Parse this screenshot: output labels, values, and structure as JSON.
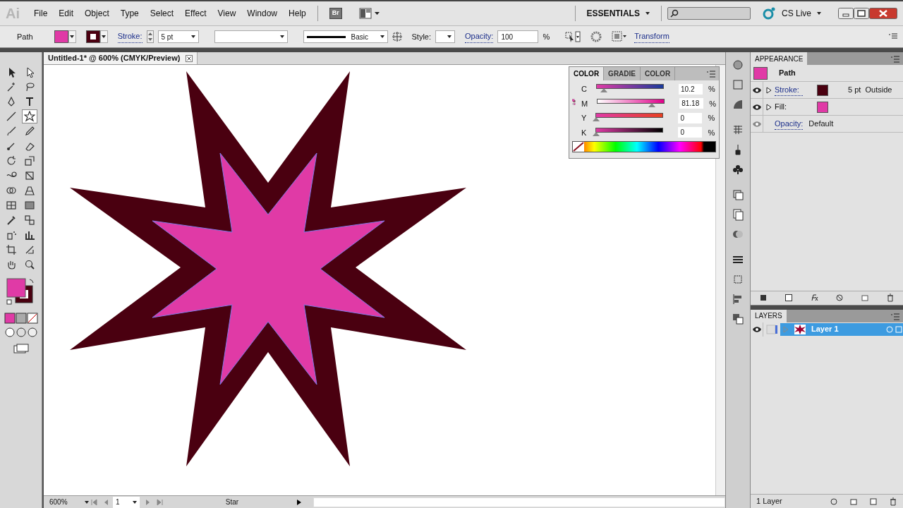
{
  "app": {
    "logo": "Ai",
    "menus": [
      "File",
      "Edit",
      "Object",
      "Type",
      "Select",
      "Effect",
      "View",
      "Window",
      "Help"
    ],
    "bridge": "Br",
    "workspace": "ESSENTIALS",
    "cs_live": "CS Live"
  },
  "control_bar": {
    "selection": "Path",
    "stroke_label": "Stroke:",
    "stroke_weight": "5 pt",
    "brush": "Basic",
    "style_label": "Style:",
    "opacity_label": "Opacity:",
    "opacity": "100",
    "percent": "%",
    "transform": "Transform"
  },
  "document": {
    "title": "Untitled-1* @ 600% (CMYK/Preview)",
    "zoom": "600%",
    "artboard": "1",
    "status": "Star"
  },
  "color_panel": {
    "tabs": [
      {
        "label": "COLOR",
        "selected": true
      },
      {
        "label": "GRADIE",
        "selected": false
      },
      {
        "label": "COLOR",
        "selected": false
      }
    ],
    "channels": [
      {
        "name": "C",
        "level": 0.102,
        "value": "10.2",
        "unit": "%"
      },
      {
        "name": "M",
        "level": 0.8118,
        "value": "81.18",
        "unit": "%"
      },
      {
        "name": "Y",
        "level": 0,
        "value": "0",
        "unit": "%"
      },
      {
        "name": "K",
        "level": 0,
        "value": "0",
        "unit": "%"
      }
    ]
  },
  "appearance": {
    "title": "APPEARANCE",
    "target": "Path",
    "rows": [
      {
        "kind": "stroke",
        "label": "Stroke:",
        "color": "#4a0010",
        "value": "5 pt  Outside"
      },
      {
        "kind": "fill",
        "label": "Fill:",
        "color": "#e03aa6"
      },
      {
        "kind": "opacity",
        "label": "Opacity:",
        "value": "Default"
      }
    ]
  },
  "layers": {
    "title": "LAYERS",
    "items": [
      {
        "name": "Layer 1",
        "selected": true
      }
    ],
    "count": "1 Layer"
  }
}
